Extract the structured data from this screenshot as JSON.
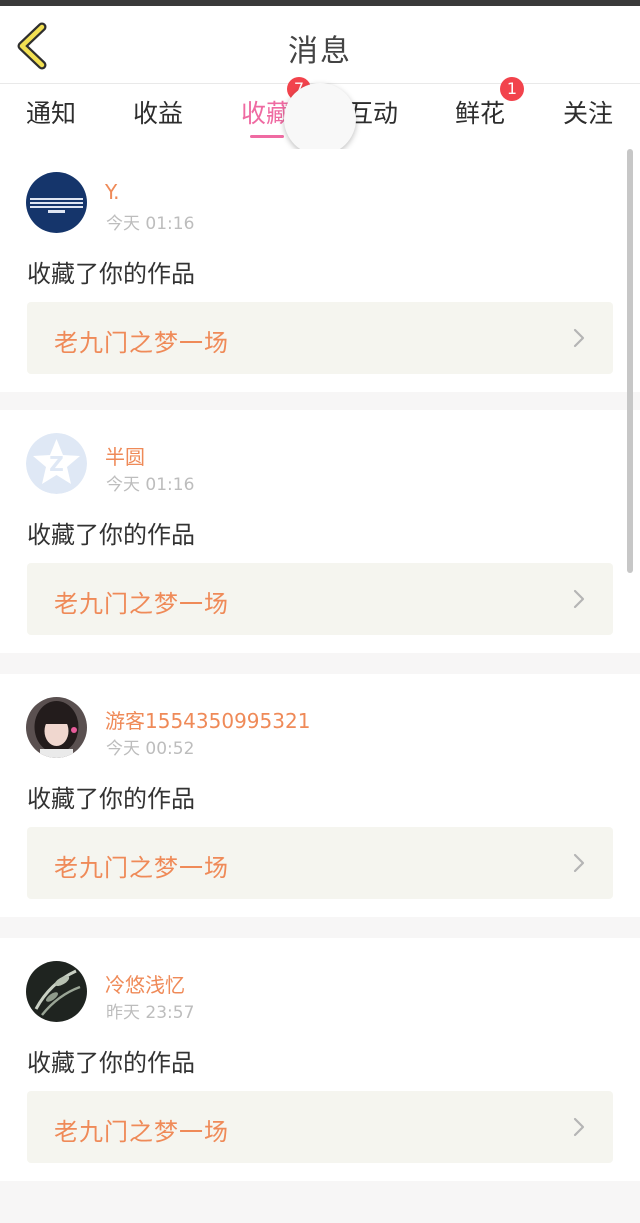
{
  "header": {
    "title": "消息"
  },
  "tabs": [
    {
      "label": "通知",
      "badge": ""
    },
    {
      "label": "收益",
      "badge": ""
    },
    {
      "label": "收藏",
      "badge": "7",
      "active": true
    },
    {
      "label": "互动",
      "badge": ""
    },
    {
      "label": "鲜花",
      "badge": "1"
    },
    {
      "label": "关注",
      "badge": ""
    }
  ],
  "items": [
    {
      "name": "Y.",
      "time": "今天 01:16",
      "action": "收藏了你的作品",
      "work": "老九门之梦一场",
      "avatar": "dark-blue-banner"
    },
    {
      "name": "半圆",
      "time": "今天 01:16",
      "action": "收藏了你的作品",
      "work": "老九门之梦一场",
      "avatar": "default-z-star"
    },
    {
      "name": "游客1554350995321",
      "time": "今天 00:52",
      "action": "收藏了你的作品",
      "work": "老九门之梦一场",
      "avatar": "girl-portrait"
    },
    {
      "name": "冷悠浅忆",
      "time": "昨天 23:57",
      "action": "收藏了你的作品",
      "work": "老九门之梦一场",
      "avatar": "dark-leaves"
    }
  ],
  "colors": {
    "accent": "#ef6aa2",
    "name": "#ef8a58",
    "badge": "#f2434c",
    "work_bg": "#f5f5ef"
  }
}
